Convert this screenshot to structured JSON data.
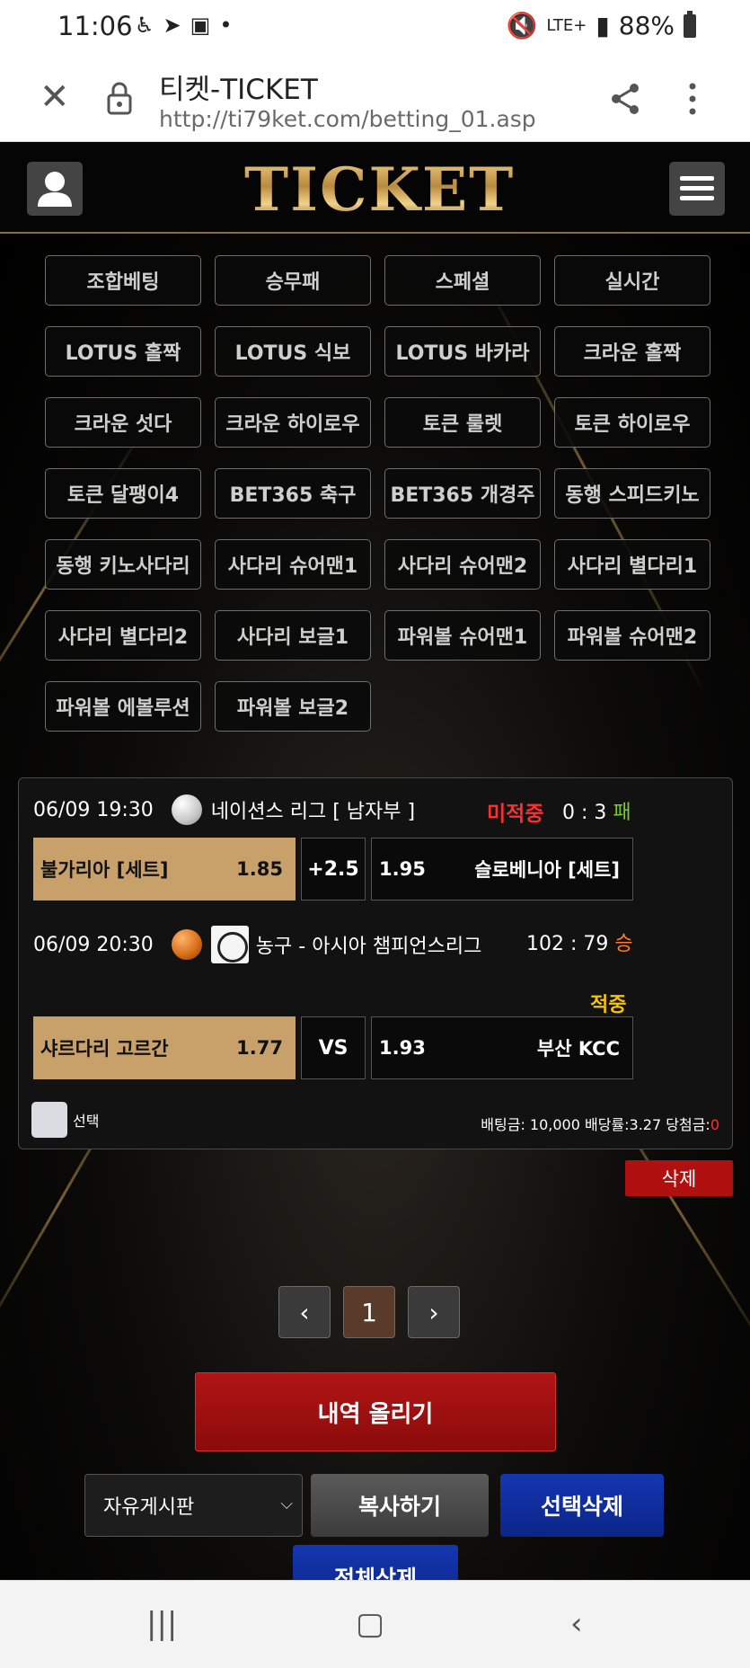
{
  "status_bar": {
    "time": "11:06",
    "network": "LTE+",
    "battery": "88%",
    "icons": [
      "accessibility-icon",
      "telegram-icon",
      "gallery-icon",
      "dot-icon",
      "mute-icon",
      "signal-icon",
      "battery-icon"
    ]
  },
  "browser": {
    "page_title": "티켓-TICKET",
    "url": "http://ti79ket.com/betting_01.asp"
  },
  "site": {
    "logo": "TICKET"
  },
  "menu": {
    "items": [
      "조합베팅",
      "승무패",
      "스페셜",
      "실시간",
      "LOTUS 홀짝",
      "LOTUS 식보",
      "LOTUS 바카라",
      "크라운 홀짝",
      "크라운 섯다",
      "크라운 하이로우",
      "토큰 룰렛",
      "토큰 하이로우",
      "토큰 달팽이4",
      "BET365 축구",
      "BET365 개경주",
      "동행 스피드키노",
      "동행 키노사다리",
      "사다리 슈어맨1",
      "사다리 슈어맨2",
      "사다리 별다리1",
      "사다리 별다리2",
      "사다리 보글1",
      "파워볼 슈어맨1",
      "파워볼 슈어맨2",
      "파워볼 에볼루션",
      "파워볼 보글2"
    ]
  },
  "bets": [
    {
      "datetime": "06/09 19:30",
      "league": "네이션스 리그 [ 남자부 ]",
      "status": "미적중",
      "score": "0 : 3",
      "result": "패",
      "home_team": "불가리아 [세트]",
      "home_odds": "1.85",
      "handicap": "+2.5",
      "away_odds": "1.95",
      "away_team": "슬로베니아 [세트]"
    },
    {
      "datetime": "06/09 20:30",
      "league": "농구 - 아시아 챔피언스리그",
      "score": "102 : 79",
      "result": "승",
      "status": "적중",
      "home_team": "샤르다리 고르간",
      "home_odds": "1.77",
      "handicap": "VS",
      "away_odds": "1.93",
      "away_team": "부산 KCC"
    }
  ],
  "slip": {
    "select_label": "선택",
    "bet_amount_label": "배팅금: 10,000 배당률:3.27 당첨금:",
    "winnings": "0",
    "delete_label": "삭제"
  },
  "pagination": {
    "prev": "‹",
    "current": "1",
    "next": "›"
  },
  "actions": {
    "upload_label": "내역 올리기",
    "board_select": "자유게시판",
    "copy_label": "복사하기",
    "delete_selected_label": "선택삭제",
    "delete_all_label": "전체삭제"
  },
  "colors": {
    "gold": "#c8a06a",
    "red": "#b01010",
    "blue": "#1436b0",
    "miss": "#ff2e2e",
    "hit": "#f5c400"
  }
}
